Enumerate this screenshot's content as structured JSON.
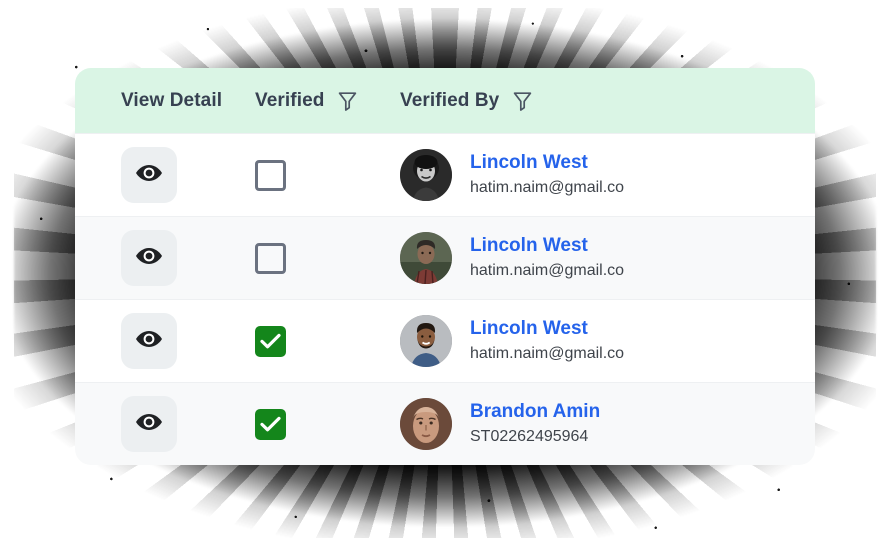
{
  "card": {
    "header": {
      "columns": [
        {
          "label": "View Detail",
          "filter": false,
          "icon": ""
        },
        {
          "label": "Verified",
          "filter": true,
          "icon": "filter-funnel-icon"
        },
        {
          "label": "Verified By",
          "filter": true,
          "icon": "filter-funnel-icon"
        }
      ]
    },
    "rows": [
      {
        "view_icon": "eye-icon",
        "verified": false,
        "verified_state_label": "unchecked",
        "name": "Lincoln West",
        "subtitle": "hatim.naim@gmail.co",
        "avatar": "avatar-photo-curly-hair-man"
      },
      {
        "view_icon": "eye-icon",
        "verified": false,
        "verified_state_label": "unchecked",
        "name": "Lincoln West",
        "subtitle": "hatim.naim@gmail.co",
        "avatar": "avatar-photo-plaid-shirt-person"
      },
      {
        "view_icon": "eye-icon",
        "verified": true,
        "verified_state_label": "checked",
        "name": "Lincoln West",
        "subtitle": "hatim.naim@gmail.co",
        "avatar": "avatar-photo-bearded-man-blue-shirt"
      },
      {
        "view_icon": "eye-icon",
        "verified": true,
        "verified_state_label": "checked",
        "name": "Brandon Amin",
        "subtitle": "ST02262495964",
        "avatar": "avatar-photo-closeup-face"
      }
    ]
  },
  "colors": {
    "header_background": "#daf5e5",
    "header_text": "#374151",
    "checkbox_checked": "#14861b",
    "checkbox_border": "#6b7280",
    "name_link": "#2563eb",
    "subtitle_text": "#3f444b",
    "row_alt_background": "#f8f9fa",
    "row_background": "#ffffff",
    "eye_button_background": "#eceff1",
    "card_background": "#ffffff"
  }
}
